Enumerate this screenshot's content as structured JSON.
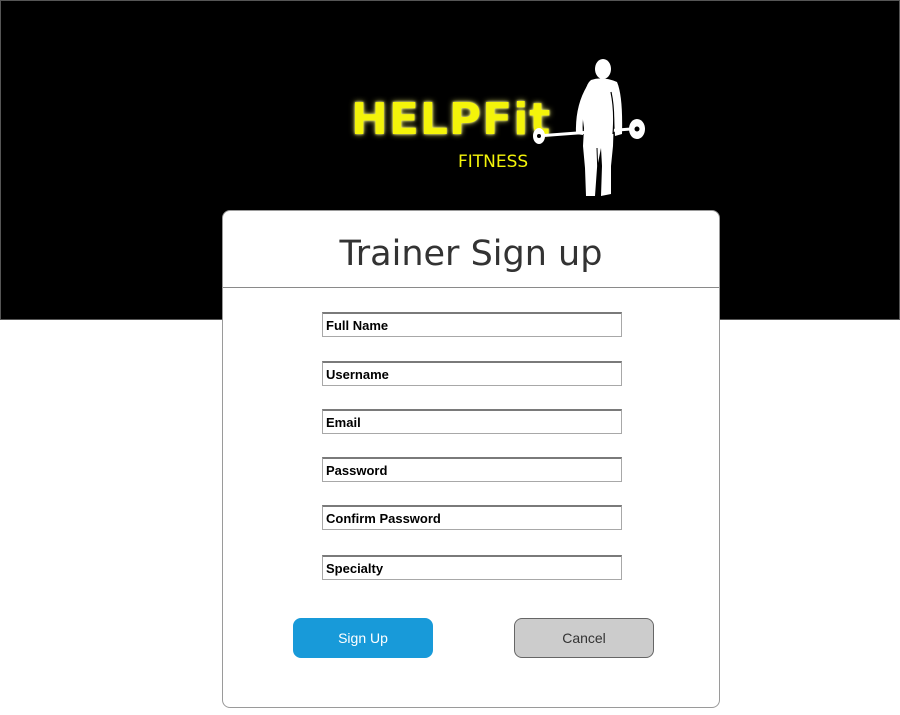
{
  "brand": {
    "name": "HELPFit",
    "tagline": "FITNESS",
    "accent_color": "#f4f40a",
    "logo_icon": "weightlifter-figure"
  },
  "form": {
    "title": "Trainer Sign up",
    "fields": [
      {
        "name": "full-name",
        "placeholder": "Full Name",
        "value": ""
      },
      {
        "name": "username",
        "placeholder": "Username",
        "value": ""
      },
      {
        "name": "email",
        "placeholder": "Email",
        "value": ""
      },
      {
        "name": "password",
        "placeholder": "Password",
        "value": ""
      },
      {
        "name": "confirm-password",
        "placeholder": "Confirm Password",
        "value": ""
      },
      {
        "name": "specialty",
        "placeholder": "Specialty",
        "value": ""
      }
    ],
    "buttons": {
      "signup_label": "Sign Up",
      "cancel_label": "Cancel"
    }
  },
  "colors": {
    "header_background": "#000000",
    "primary_button": "#189ad9",
    "secondary_button": "#cccccc"
  }
}
